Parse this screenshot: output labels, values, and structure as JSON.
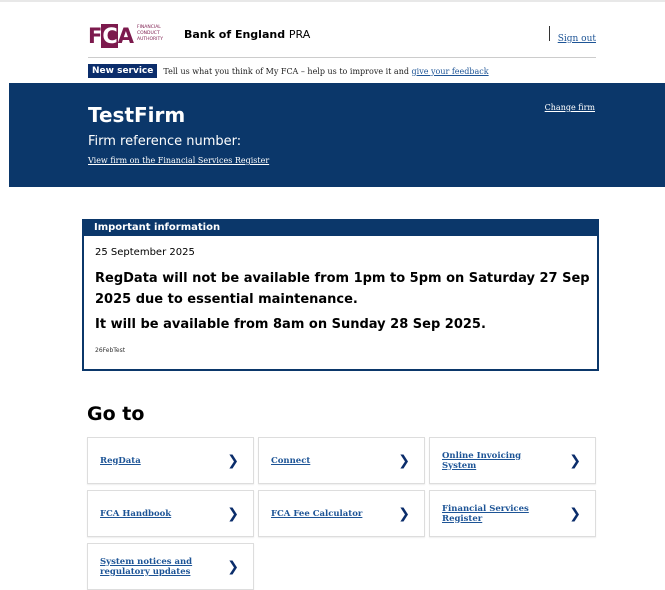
{
  "header": {
    "fca_logo_text": "FCA",
    "fca_subtext": "Financial Conduct Authority",
    "boe_name": "Bank of England",
    "boe_suffix": "PRA",
    "sign_out": "Sign out"
  },
  "banner": {
    "tag": "New service",
    "text": "Tell us what you think of My FCA – help us to improve it and",
    "link": "give your feedback"
  },
  "firm": {
    "name": "TestFirm",
    "reference_label": "Firm reference number:",
    "view_link": "View firm on the Financial Services Register",
    "change_link": "Change firm"
  },
  "important": {
    "title": "Important information",
    "date": "25 September 2025",
    "message1": "RegData will not be available from 1pm to 5pm on Saturday 27 Sep 2025 due to essential maintenance.",
    "message2": "It will be available from 8am on Sunday 28 Sep 2025.",
    "footnote": "26FebTest"
  },
  "goto": {
    "title": "Go to",
    "tiles": [
      {
        "label": "RegData"
      },
      {
        "label": "Connect"
      },
      {
        "label": "Online Invoicing System"
      },
      {
        "label": "FCA Handbook"
      },
      {
        "label": "FCA Fee Calculator"
      },
      {
        "label": "Financial Services Register"
      },
      {
        "label": "System notices and regulatory updates"
      }
    ],
    "arrow": "❯"
  },
  "colors": {
    "navy": "#0b376a",
    "fca_maroon": "#7c1a4d",
    "link": "#1d5496"
  }
}
